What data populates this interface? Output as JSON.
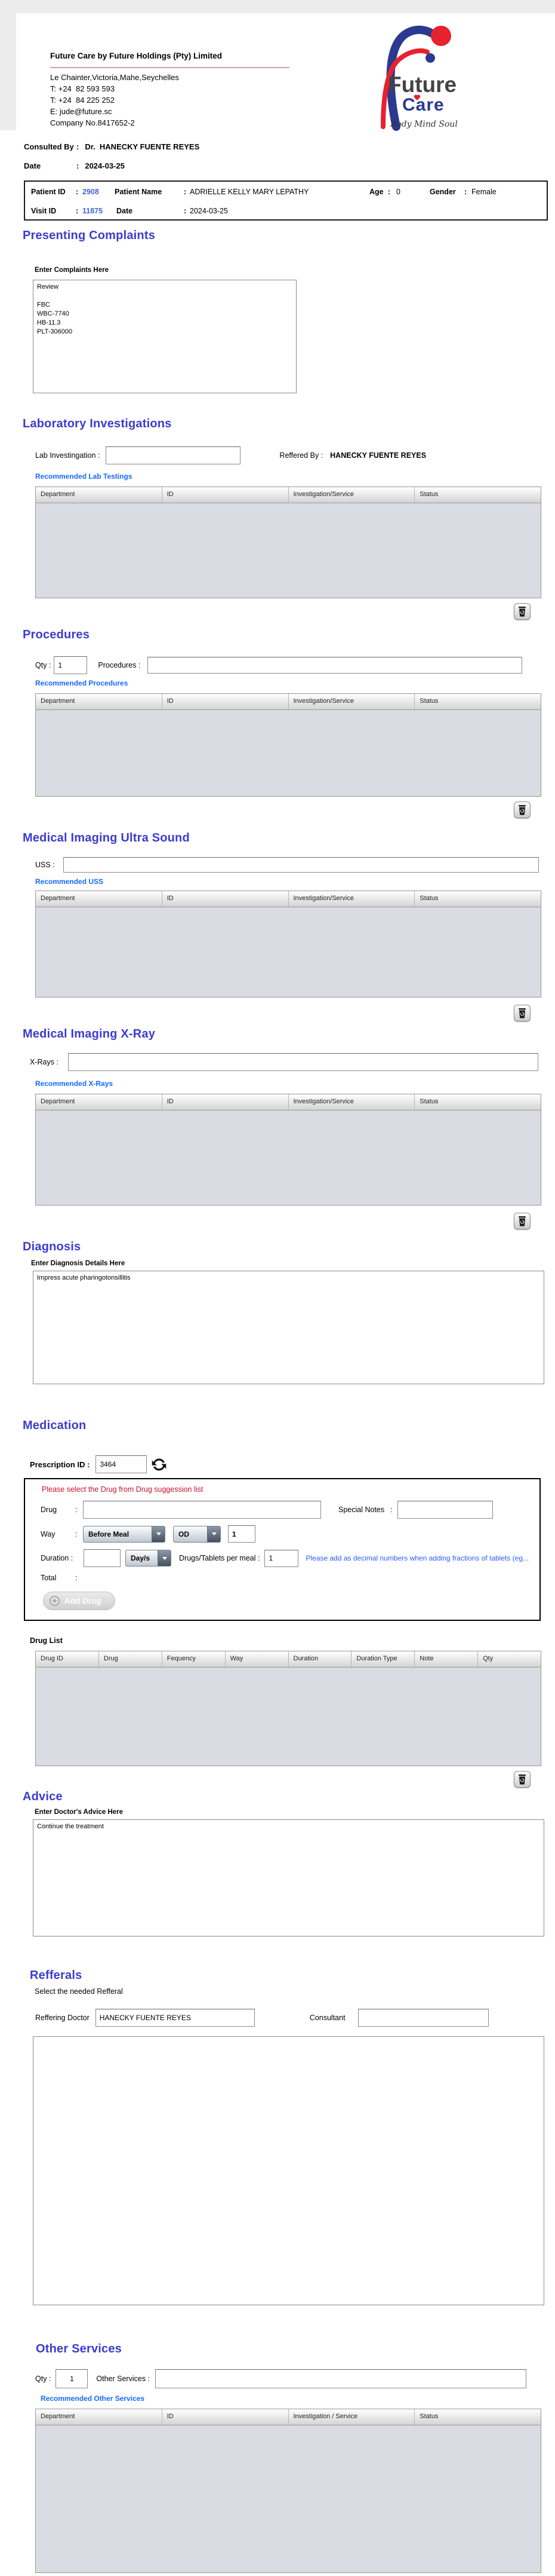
{
  "ui": {
    "colon": ":"
  },
  "colors": {
    "heading_blue": "#3b3bd1",
    "link_blue": "#1569ff",
    "id_blue": "#4169d0",
    "warning_red": "#c8102e",
    "note_blue": "#2b5cff",
    "logo_blue": "#2b3990",
    "logo_red": "#e8212e",
    "table_body_grey": "#d9dce3"
  },
  "header": {
    "company_name": "Future Care by Future Holdings (Pty) Limited",
    "address": "Le Chainter,Victoria,Mahe,Seychelles",
    "phone1": "T: +24  82 593 593",
    "phone2": "T: +24  84 225 252",
    "email": "E: jude@future.sc",
    "company_no": "Company No.8417652-2",
    "logo": {
      "line1": "Future",
      "line2": "Care",
      "tagline": "Body Mind Soul"
    }
  },
  "consultation": {
    "consulted_by_label": "Consulted By",
    "consulted_by": "Dr.  HANECKY FUENTE REYES",
    "date_label": "Date",
    "date": "2024-03-25"
  },
  "patient": {
    "patient_id_label": "Patient ID",
    "patient_id": "2908",
    "patient_name_label": "Patient Name",
    "patient_name": "ADRIELLE KELLY MARY LEPATHY",
    "age_label": "Age",
    "age": "0",
    "gender_label": "Gender",
    "gender": "Female",
    "visit_id_label": "Visit ID",
    "visit_id": "11875",
    "visit_date_label": "Date",
    "visit_date": "2024-03-25"
  },
  "complaints": {
    "title": "Presenting Complaints",
    "hint": "Enter Complaints Here",
    "text": "Review\n\nFBC\nWBC-7740\nHB-11.3\nPLT-306000"
  },
  "laboratory": {
    "title": "Laboratory  Investigations",
    "label": "Lab Investingation :",
    "value": "",
    "referred_by_label": "Reffered By :",
    "referred_by": "HANECKY FUENTE REYES",
    "link": "Recommended Lab Testings"
  },
  "procedures": {
    "title": "Procedures",
    "qty_label": "Qty :",
    "qty": "1",
    "label": "Procedures :",
    "value": "",
    "link": "Recommended Procedures"
  },
  "ultrasound": {
    "title": "Medical Imaging Ultra Sound",
    "label": "USS :",
    "value": "",
    "link": "Recommended USS"
  },
  "xray": {
    "title": "Medical Imaging X-Ray",
    "label": "X-Rays :",
    "value": "",
    "link": "Recommended X-Rays"
  },
  "diagnosis": {
    "title": "Diagnosis",
    "hint": "Enter Diagnosis Details Here",
    "text": "Impress acute pharingotonsillitis"
  },
  "medication": {
    "title": "Medication",
    "prescription_label": "Prescription ID :",
    "prescription_id": "3464",
    "warning": "Please select the Drug from Drug suggession list",
    "drug_label": "Drug",
    "drug_value": "",
    "special_notes_label": "Special Notes",
    "special_notes_value": "",
    "way_label": "Way",
    "meal_option": "Before Meal",
    "frequency_option": "OD",
    "frequency_qty": "1",
    "duration_label": "Duration :",
    "duration_value": "",
    "duration_unit": "Day/s",
    "per_meal_label": "Drugs/Tablets per meal :",
    "per_meal_value": "1",
    "note": "Please add as decimal numbers when adding fractions of tablets (eg...",
    "total_label": "Total",
    "add_drug": "Add Drug",
    "drug_list_title": "Drug List"
  },
  "advice": {
    "title": "Advice",
    "hint": "Enter Doctor's Advice Here",
    "text": "Continue the treatment"
  },
  "referrals": {
    "title": "Refferals",
    "hint": "Select the needed Refferal",
    "doctor_label": "Reffering Doctor",
    "doctor": "HANECKY FUENTE REYES",
    "consultant_label": "Consultant",
    "consultant": ""
  },
  "other_services": {
    "title": "Other Services",
    "qty_label": "Qty :",
    "qty": "1",
    "label": "Other Services :",
    "value": "",
    "link": "Recommended Other Services"
  },
  "tables": {
    "service_headers": [
      "Department",
      "ID",
      "Investigation/Service",
      "Status"
    ],
    "other_headers": [
      "Department",
      "ID",
      "Investigation / Service",
      "Status"
    ],
    "drug_headers": [
      "Drug ID",
      "Drug",
      "Fequency",
      "Way",
      "Duration",
      "Duration Type",
      "Note",
      "Qty"
    ]
  }
}
